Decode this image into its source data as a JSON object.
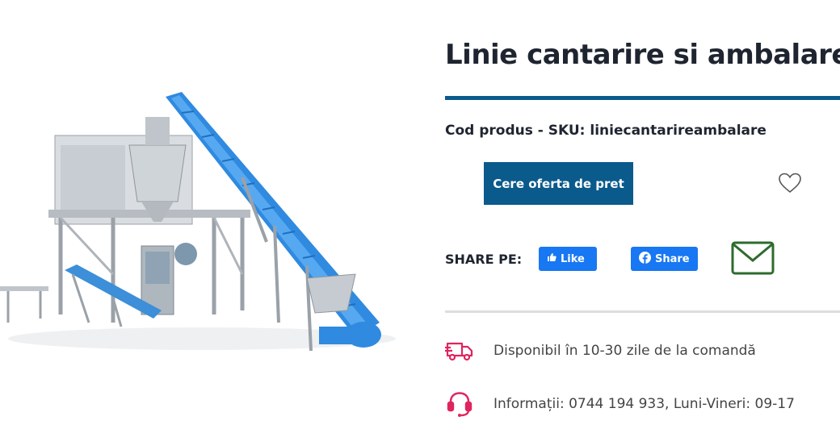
{
  "product": {
    "title": "Linie cantarire si ambalare",
    "sku_text": "Cod produs - SKU: liniecantarireambalare",
    "image_alt": "linie cantarire si ambalare"
  },
  "actions": {
    "quote_label": "Cere oferta de pret",
    "wishlist_icon": "heart-icon"
  },
  "share": {
    "label": "SHARE PE:",
    "like_label": "Like",
    "share_label": "Share",
    "mail_icon": "envelope-icon",
    "facebook_color": "#1877f2",
    "mail_color": "#2e6b2e"
  },
  "info": {
    "availability": "Disponibil în 10-30 zile de la comandă",
    "contact": "Informații: 0744 194 933, Luni-Vineri: 09-17"
  },
  "colors": {
    "accent": "#0b5a8c",
    "icon_pink": "#e0245e"
  }
}
